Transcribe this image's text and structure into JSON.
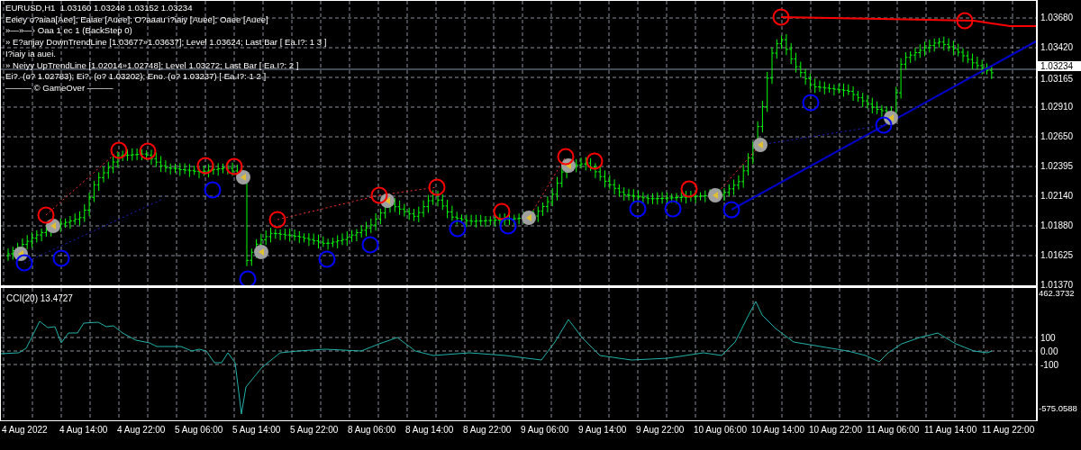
{
  "chart": {
    "header": "EURUSD,H1  1.03160 1.03248 1.03152 1.03234",
    "info_lines": [
      "Eeiey o?aiaa[Aee]; Eaiae [Auee]; O?aaau i?iaiy [Auee]; Oaee [Auee]",
      "»—»—› Oaa 1 ec 1 (BackStep 0)",
      "» E?anjay DownTrendLine [1.03677»1.03637]; Level 1.03624; Last Bar [ Ea.I?: 1 3 ]",
      "I?iaiy ia auei.",
      "» Neiyy UpTrendLine [1.02014»1.02748]; Level 1.03272; Last Bar [ Ea.I?: 2 ]",
      "Ei?. (o? 1.02783); Ei?. (o? 1.03202); Eno. (o? 1.03237) [ Ea.I?: 1 2 ]",
      "——— © GameOver ———"
    ],
    "price_axis": [
      "1.03680",
      "1.03420",
      "1.03165",
      "1.02910",
      "1.02650",
      "1.02395",
      "1.02140",
      "1.01880",
      "1.01625",
      "1.01370"
    ],
    "current_price": "1.03234"
  },
  "indicator": {
    "title": "CCI(20) 13.4727",
    "axis": [
      "462.3732",
      "100",
      "0.00",
      "-100",
      "-575.0588"
    ]
  },
  "time_axis": [
    "4 Aug 2022",
    "4 Aug 14:00",
    "4 Aug 22:00",
    "5 Aug 06:00",
    "5 Aug 14:00",
    "5 Aug 22:00",
    "8 Aug 06:00",
    "8 Aug 14:00",
    "8 Aug 22:00",
    "9 Aug 06:00",
    "9 Aug 14:00",
    "9 Aug 22:00",
    "10 Aug 06:00",
    "10 Aug 14:00",
    "10 Aug 22:00",
    "11 Aug 06:00",
    "11 Aug 14:00",
    "11 Aug 22:00"
  ]
}
